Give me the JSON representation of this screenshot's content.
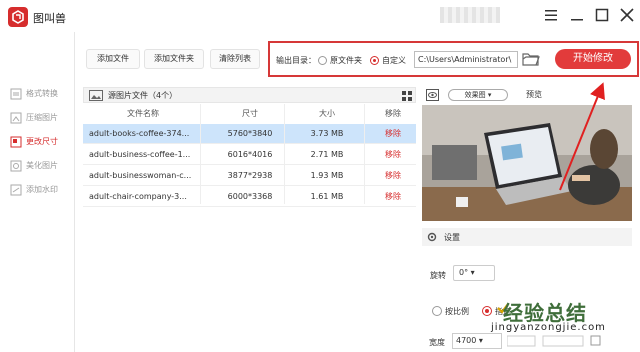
{
  "app": {
    "title": "图叫兽"
  },
  "sidebar": {
    "items": [
      {
        "label": "格式转换",
        "icon": "convert-icon"
      },
      {
        "label": "压缩图片",
        "icon": "compress-icon"
      },
      {
        "label": "更改尺寸",
        "icon": "resize-icon",
        "active": true
      },
      {
        "label": "美化图片",
        "icon": "beautify-icon"
      },
      {
        "label": "添加水印",
        "icon": "watermark-icon"
      }
    ]
  },
  "toolbar": {
    "add_file": "添加文件",
    "add_folder": "添加文件夹",
    "clear_list": "清除列表",
    "output_label": "输出目录：",
    "opt_source": "原文件夹",
    "opt_custom": "自定义",
    "selected_option": "自定义",
    "output_path": "C:\\Users\\Administrator\\",
    "start_button": "开始修改"
  },
  "file_list": {
    "header": "源图片文件（4个）",
    "columns": [
      "文件名称",
      "尺寸",
      "大小",
      "移除"
    ],
    "rows": [
      {
        "name": "adult-books-coffee-374...",
        "dimensions": "5760*3840",
        "size": "3.73 MB",
        "remove": "移除",
        "selected": true
      },
      {
        "name": "adult-business-coffee-1...",
        "dimensions": "6016*4016",
        "size": "2.71 MB",
        "remove": "移除"
      },
      {
        "name": "adult-businesswoman-c...",
        "dimensions": "3877*2938",
        "size": "1.93 MB",
        "remove": "移除"
      },
      {
        "name": "adult-chair-company-3...",
        "dimensions": "6000*3368",
        "size": "1.61 MB",
        "remove": "移除"
      }
    ]
  },
  "preview": {
    "mode": "效果图",
    "label": "预览"
  },
  "settings": {
    "title": "设置",
    "rotate_label": "旋转",
    "rotate_value": "0°",
    "by_ratio": "按比例",
    "specified": "指定",
    "width_label": "宽度",
    "width_value": "4700"
  },
  "watermark": {
    "main": "经验总结",
    "sub": "jingyanzongjie.com"
  },
  "colors": {
    "accent": "#d62d2d",
    "selected_row": "#cde4fb"
  }
}
